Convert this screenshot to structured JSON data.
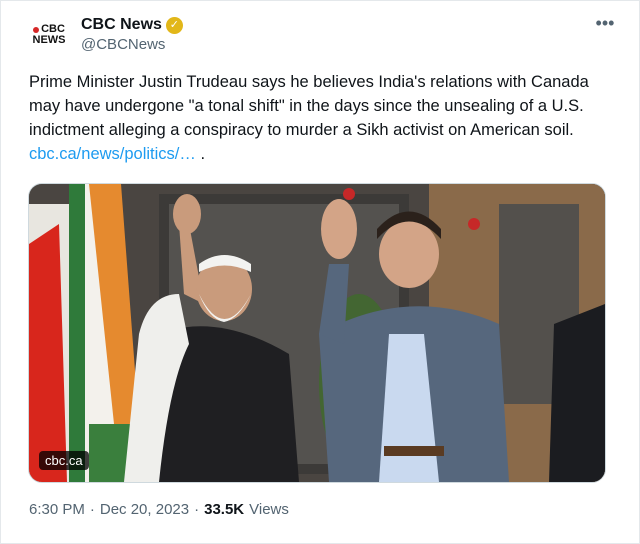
{
  "header": {
    "avatar_text_top": "CBC",
    "avatar_text_bottom": "NEWS",
    "display_name": "CBC News",
    "handle": "@CBCNews",
    "more_label": "•••"
  },
  "tweet": {
    "text": "Prime Minister Justin Trudeau says he believes India's relations with Canada may have undergone \"a tonal shift\" in the days since the unsealing of a U.S. indictment alleging a conspiracy to murder a Sikh activist on American soil. ",
    "link_text": "cbc.ca/news/politics/…",
    "trailing": " ."
  },
  "media": {
    "label": "cbc.ca"
  },
  "meta": {
    "time": "6:30 PM",
    "date": "Dec 20, 2023",
    "views_count": "33.5K",
    "views_label": "Views"
  },
  "colors": {
    "accent": "#1d9bf0",
    "verified_badge": "#e2b719",
    "muted": "#536471"
  }
}
